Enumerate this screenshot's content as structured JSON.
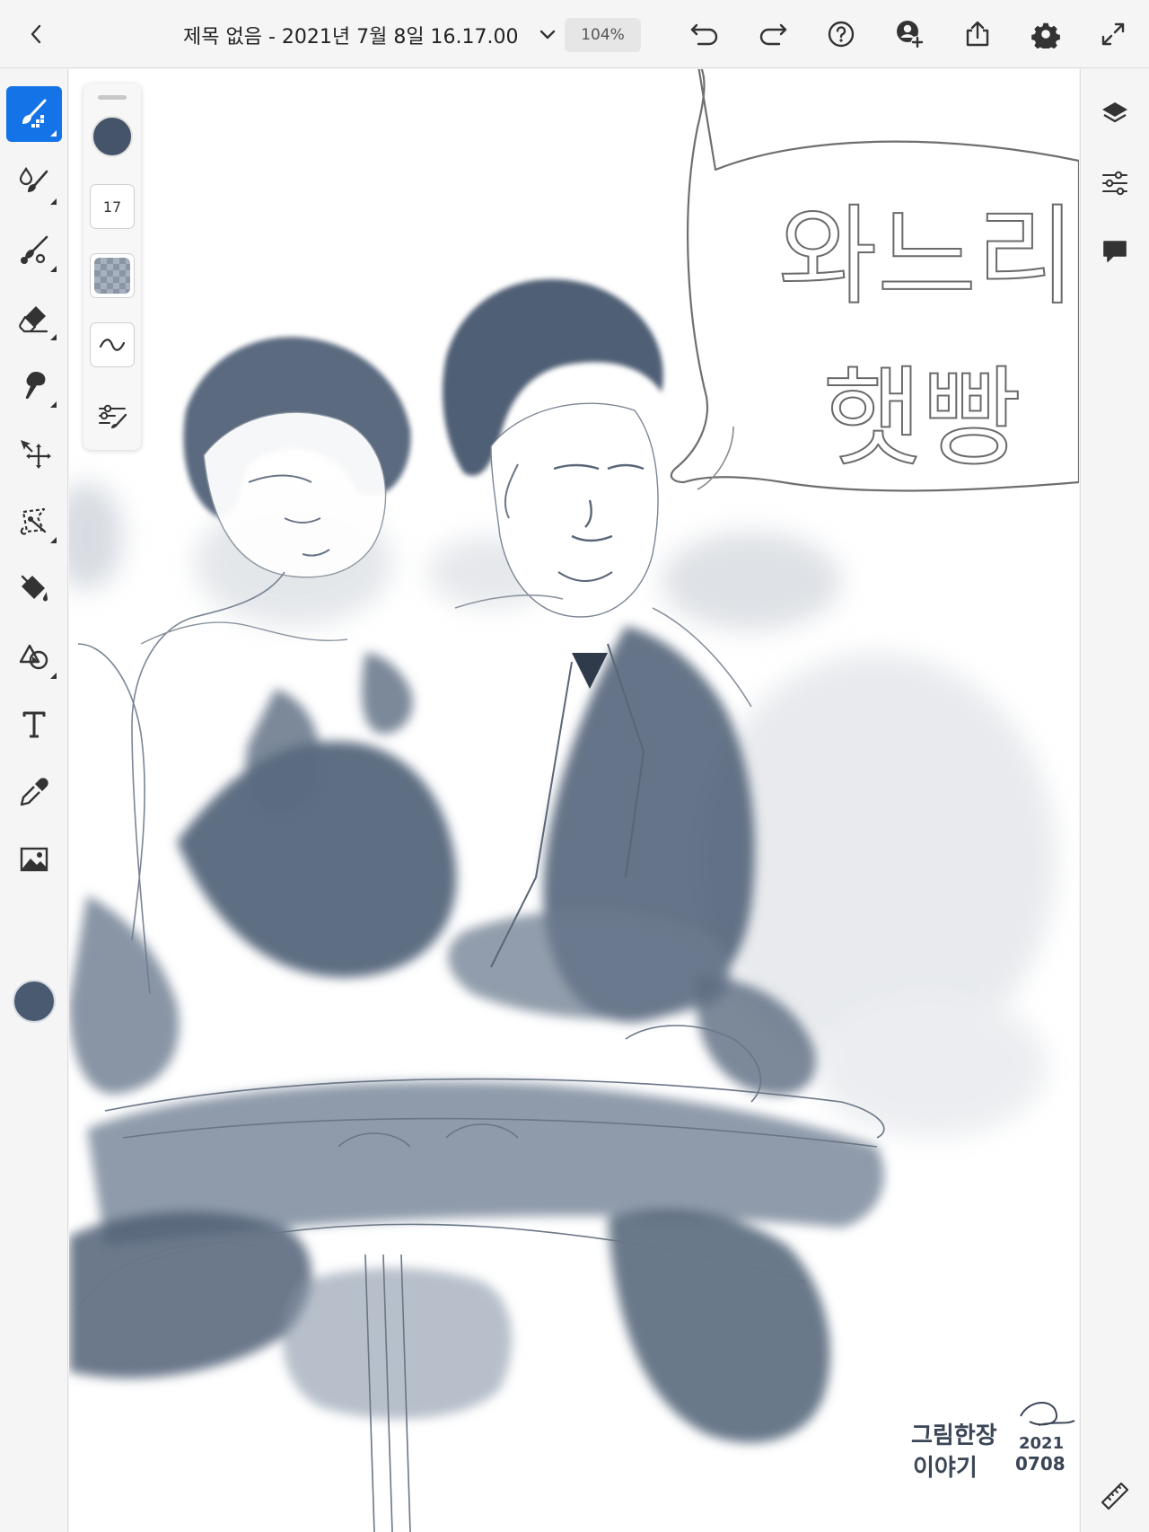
{
  "header": {
    "document_title": "제목 없음 - 2021년 7월 8일 16.17.00",
    "zoom": "104%"
  },
  "brush_panel": {
    "brush_size": "17",
    "brush_color": "#455469"
  },
  "toolbar": {
    "active_tool": "pixel-brush",
    "current_color": "#4a5a70"
  },
  "artwork": {
    "speech_bubble_text": [
      "와느리",
      "햇빵"
    ],
    "signature_lines": [
      "그림한장",
      "이야기"
    ],
    "signature_date": [
      "2021",
      "0708"
    ]
  },
  "colors": {
    "accent": "#1473e6",
    "ink": "#4a5a70",
    "wash": "#9aa6b6"
  }
}
